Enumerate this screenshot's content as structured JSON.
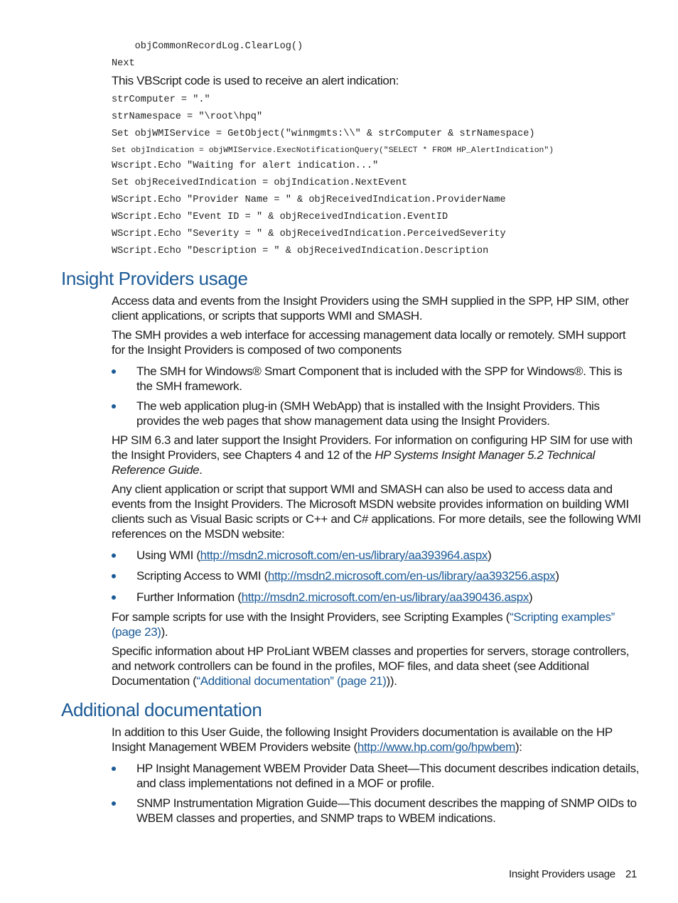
{
  "code_top": {
    "lines": [
      "    objCommonRecordLog.ClearLog()",
      "Next"
    ]
  },
  "intro_text": "This VBScript code is used to receive an alert indication:",
  "code_alert": {
    "lines": [
      "strComputer = \".\"",
      "strNamespace = \"\\root\\hpq\"",
      "Set objWMIService = GetObject(\"winmgmts:\\\\\" & strComputer & strNamespace)",
      "Set objIndication = objWMIService.ExecNotificationQuery(\"SELECT * FROM HP_AlertIndication\")",
      "Wscript.Echo \"Waiting for alert indication...\"",
      "Set objReceivedIndication = objIndication.NextEvent",
      "WScript.Echo \"Provider Name = \" & objReceivedIndication.ProviderName",
      "WScript.Echo \"Event ID = \" & objReceivedIndication.EventID",
      "WScript.Echo \"Severity = \" & objReceivedIndication.PerceivedSeverity",
      "WScript.Echo \"Description = \" & objReceivedIndication.Description"
    ]
  },
  "section1": {
    "heading": "Insight Providers usage",
    "p1": "Access data and events from the Insight Providers using the SMH supplied in the SPP, HP SIM, other client applications, or scripts that supports WMI and SMASH.",
    "p2": "The SMH provides a web interface for accessing management data locally or remotely. SMH support for the Insight Providers is composed of two components",
    "bullets1": [
      "The SMH for Windows® Smart Component that is included with the SPP for Windows®. This is the SMH framework.",
      "The web application plug-in (SMH WebApp) that is installed with the Insight Providers. This provides the web pages that show management data using the Insight Providers."
    ],
    "p3_pre": "HP SIM 6.3 and later support the Insight Providers. For information on configuring HP SIM for use with the Insight Providers, see Chapters 4 and 12 of the ",
    "p3_em": "HP Systems Insight Manager 5.2 Technical Reference Guide",
    "p3_post": ".",
    "p4": "Any client application or script that support WMI and SMASH can also be used to access data and events from the Insight Providers. The Microsoft MSDN website provides information on building WMI clients such as Visual Basic scripts or C++ and C# applications. For more details, see the following WMI references on the MSDN website:",
    "msdn_links": [
      {
        "label": "Using WMI (",
        "url": "http://msdn2.microsoft.com/en-us/library/aa393964.aspx",
        "close": ")"
      },
      {
        "label": "Scripting Access to WMI (",
        "url": "http://msdn2.microsoft.com/en-us/library/aa393256.aspx",
        "close": ")"
      },
      {
        "label": "Further Information (",
        "url": "http://msdn2.microsoft.com/en-us/library/aa390436.aspx",
        "close": ")"
      }
    ],
    "p5_pre": "For sample scripts for use with the Insight Providers, see Scripting Examples (",
    "p5_xref": "“Scripting examples” (page 23)",
    "p5_post": ").",
    "p6_pre": "Specific information about HP ProLiant WBEM classes and properties for servers, storage controllers, and network controllers can be found in the profiles, MOF files, and data sheet (see Additional Documentation (",
    "p6_xref": "“Additional documentation” (page 21)",
    "p6_post": ")).",
    "colors": {
      "heading": "#1b5a96",
      "link": "#1b5a96",
      "bullet": "#1b5a96"
    }
  },
  "section2": {
    "heading": "Additional documentation",
    "p1_pre": "In addition to this User Guide, the following Insight Providers documentation is available on the HP Insight Management WBEM Providers website (",
    "p1_link": "http://www.hp.com/go/hpwbem",
    "p1_post": "):",
    "bullets": [
      "HP Insight Management WBEM Provider Data Sheet—This document describes indication details, and class implementations not defined in a MOF or profile.",
      "SNMP Instrumentation Migration Guide—This document describes the mapping of SNMP OIDs to WBEM classes and properties, and SNMP traps to WBEM indications."
    ]
  },
  "footer": {
    "section_title": "Insight Providers usage",
    "page_number": "21"
  }
}
